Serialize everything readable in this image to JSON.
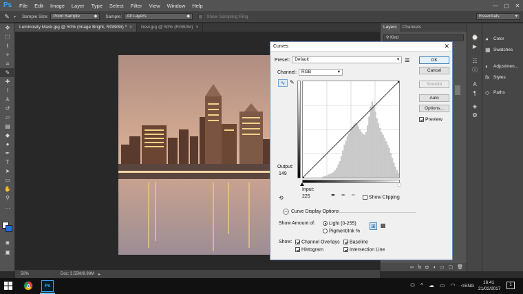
{
  "app": {
    "logo": "Ps",
    "menu": [
      "File",
      "Edit",
      "Image",
      "Layer",
      "Type",
      "Select",
      "Filter",
      "View",
      "Window",
      "Help"
    ],
    "window_controls": [
      "—",
      "▢",
      "✕"
    ]
  },
  "options_bar": {
    "sample_size_label": "Sample Size:",
    "sample_size_value": "Point Sample",
    "sample_label": "Sample:",
    "sample_value": "All Layers",
    "sampling_ring_label": "Show Sampling Ring",
    "workspace": "Essentials"
  },
  "doc_tabs": [
    {
      "label": "Luminosity Mask.jpg @ 50% (Image Bright, RGB/8#) *",
      "active": true
    },
    {
      "label": "New.jpg @ 50% (RGB/8#)",
      "active": false
    }
  ],
  "status_bar": {
    "zoom": "50%",
    "doc": "Doc: 3.55M/8.98M"
  },
  "layers_panel": {
    "tabs": [
      "Layers",
      "Channels"
    ],
    "kind": "Kind"
  },
  "right_panels": [
    {
      "icon": "color-icon",
      "label": "Color"
    },
    {
      "icon": "swatches-icon",
      "label": "Swatches"
    },
    {
      "icon": "adjustments-icon",
      "label": "Adjustmen..."
    },
    {
      "icon": "styles-icon",
      "label": "Styles"
    },
    {
      "icon": "paths-icon",
      "label": "Paths"
    }
  ],
  "curves_dialog": {
    "title": "Curves",
    "preset_label": "Preset:",
    "preset_value": "Default",
    "channel_label": "Channel:",
    "channel_value": "RGB",
    "output_label": "Output:",
    "output_value": "149",
    "input_label": "Input:",
    "input_value": "225",
    "show_clipping": "Show Clipping",
    "curve_display_options": "Curve Display Options",
    "show_amount_label": "Show Amount of:",
    "light_option": "Light  (0-255)",
    "pigment_option": "Pigment/Ink %",
    "show_label": "Show:",
    "channel_overlays": "Channel Overlays",
    "baseline": "Baseline",
    "histogram": "Histogram",
    "intersection_line": "Intersection Line",
    "buttons": {
      "ok": "OK",
      "cancel": "Cancel",
      "smooth": "Smooth",
      "auto": "Auto",
      "options": "Options..."
    },
    "preview_label": "Preview",
    "histogram_levels": [
      1,
      2,
      2,
      3,
      4,
      5,
      6,
      7,
      9,
      12,
      16,
      20,
      26,
      33,
      40,
      45,
      50,
      54,
      58,
      61,
      64,
      66,
      65,
      62,
      58,
      55,
      53,
      52,
      55,
      63,
      74,
      86,
      92,
      88,
      80,
      72,
      66,
      60,
      55,
      52,
      48,
      44,
      40,
      36,
      30,
      24,
      18,
      13,
      9,
      6
    ]
  },
  "taskbar": {
    "time": "16:41",
    "date": "21/02/2017",
    "language": "ENG",
    "notification_count": "1"
  }
}
